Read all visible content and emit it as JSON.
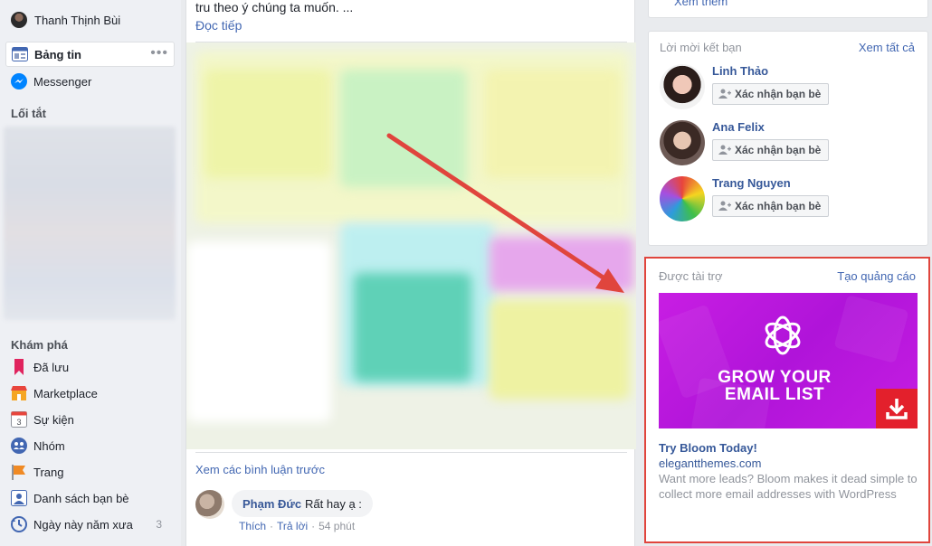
{
  "sidebar": {
    "profile_name": "Thanh Thịnh Bùi",
    "items_top": [
      {
        "label": "Bảng tin",
        "icon": "news-feed-icon"
      },
      {
        "label": "Messenger",
        "icon": "messenger-icon"
      }
    ],
    "more": "•••",
    "shortcuts_title": "Lối tắt",
    "explore_title": "Khám phá",
    "explore_items": [
      {
        "label": "Đã lưu",
        "icon": "bookmark-icon"
      },
      {
        "label": "Marketplace",
        "icon": "marketplace-icon"
      },
      {
        "label": "Sự kiện",
        "icon": "calendar-icon",
        "icon_text": "3"
      },
      {
        "label": "Nhóm",
        "icon": "groups-icon"
      },
      {
        "label": "Trang",
        "icon": "flag-icon"
      },
      {
        "label": "Danh sách bạn bè",
        "icon": "friends-list-icon"
      },
      {
        "label": "Ngày này năm xưa",
        "icon": "memories-icon",
        "count": "3"
      }
    ]
  },
  "feed": {
    "post_text": "tru theo ý chúng ta muốn. ...",
    "read_more": "Đọc tiếp",
    "see_previous": "Xem các bình luận trước",
    "comment": {
      "author": "Phạm Đức",
      "text": "Rất hay ạ :",
      "like": "Thích",
      "reply": "Trả lời",
      "time": "54 phút",
      "sep": "·"
    }
  },
  "right": {
    "top_link": "Xem thêm",
    "friend_requests": {
      "title": "Lời mời kết bạn",
      "see_all": "Xem tất cả",
      "confirm_label": "Xác nhận bạn bè",
      "people": [
        {
          "name": "Linh Thảo"
        },
        {
          "name": "Ana Felix"
        },
        {
          "name": "Trang Nguyen"
        }
      ]
    },
    "sponsored": {
      "title": "Được tài trợ",
      "create_ad": "Tạo quảng cáo",
      "headline_line1": "GROW YOUR",
      "headline_line2": "EMAIL LIST",
      "link_title": "Try Bloom Today!",
      "domain": "elegantthemes.com",
      "description": "Want more leads? Bloom makes it dead simple to collect more email addresses with WordPress"
    }
  },
  "colors": {
    "link": "#4267b2",
    "name": "#365899",
    "annotation_red": "#e0453d",
    "ad_purple": "#c01ade"
  }
}
